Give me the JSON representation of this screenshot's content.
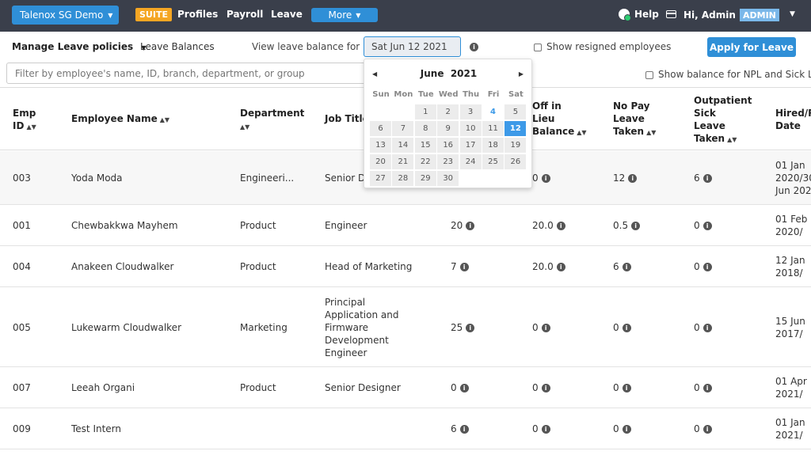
{
  "nav": {
    "company": "Talenox SG Demo",
    "suite": "SUITE",
    "links": [
      "Profiles",
      "Payroll",
      "Leave"
    ],
    "more": "More",
    "help": "Help",
    "greeting": "Hi, Admin",
    "role": "ADMIN"
  },
  "toolbar": {
    "manage": "Manage Leave policies",
    "balances": "Leave Balances",
    "view_label": "View leave balance for",
    "date_value": "Sat Jun 12 2021",
    "show_resigned": "Show resigned employees",
    "apply": "Apply for Leave",
    "filter_placeholder": "Filter by employee's name, ID, branch, department, or group",
    "show_npl": "Show balance for NPL and Sick Le"
  },
  "table": {
    "headers": {
      "emp_id": [
        "Emp",
        "ID"
      ],
      "name": "Employee Name",
      "department": "Department",
      "job_title": "Job Title",
      "lieu": [
        "Off in",
        "Lieu",
        "Balance"
      ],
      "no_pay": [
        "No Pay",
        "Leave",
        "Taken"
      ],
      "sick": [
        "Outpatient",
        "Sick",
        "Leave",
        "Taken"
      ],
      "hired": [
        "Hired/R",
        "Date"
      ]
    },
    "rows": [
      {
        "id": "003",
        "name": "Yoda Moda",
        "department": "Engineeri...",
        "job": [
          "Senior D"
        ],
        "balance": "",
        "lieu": "0",
        "no_pay": "12",
        "sick": "6",
        "hired": [
          "01 Jan",
          "2020/30",
          "Jun 202"
        ]
      },
      {
        "id": "001",
        "name": "Chewbakkwa Mayhem",
        "department": "Product",
        "job": [
          "Engineer"
        ],
        "balance": "20",
        "lieu": "20.0",
        "no_pay": "0.5",
        "sick": "0",
        "hired": [
          "01 Feb",
          "2020/"
        ]
      },
      {
        "id": "004",
        "name": "Anakeen Cloudwalker",
        "department": "Product",
        "job": [
          "Head of Marketing"
        ],
        "balance": "7",
        "lieu": "20.0",
        "no_pay": "6",
        "sick": "0",
        "hired": [
          "12 Jan",
          "2018/"
        ]
      },
      {
        "id": "005",
        "name": "Lukewarm Cloudwalker",
        "department": "Marketing",
        "job": [
          "Principal",
          "Application and",
          "Firmware",
          "Development",
          "Engineer"
        ],
        "balance": "25",
        "lieu": "0",
        "no_pay": "0",
        "sick": "0",
        "hired": [
          "15 Jun",
          "2017/"
        ]
      },
      {
        "id": "007",
        "name": "Leeah Organi",
        "department": "Product",
        "job": [
          "Senior Designer"
        ],
        "balance": "0",
        "lieu": "0",
        "no_pay": "0",
        "sick": "0",
        "hired": [
          "01 Apr",
          "2021/"
        ]
      },
      {
        "id": "009",
        "name": "Test Intern",
        "department": "",
        "job": [
          ""
        ],
        "balance": "6",
        "lieu": "0",
        "no_pay": "0",
        "sick": "0",
        "hired": [
          "01 Jan",
          "2021/"
        ]
      }
    ]
  },
  "datepicker": {
    "month": "June",
    "year": "2021",
    "daynames": [
      "Sun",
      "Mon",
      "Tue",
      "Wed",
      "Thu",
      "Fri",
      "Sat"
    ],
    "weeks": [
      [
        "",
        "",
        "1",
        "2",
        "3",
        "4",
        "5"
      ],
      [
        "6",
        "7",
        "8",
        "9",
        "10",
        "11",
        "12"
      ],
      [
        "13",
        "14",
        "15",
        "16",
        "17",
        "18",
        "19"
      ],
      [
        "20",
        "21",
        "22",
        "23",
        "24",
        "25",
        "26"
      ],
      [
        "27",
        "28",
        "29",
        "30",
        "",
        "",
        ""
      ]
    ],
    "selected": "12",
    "today": "4"
  }
}
